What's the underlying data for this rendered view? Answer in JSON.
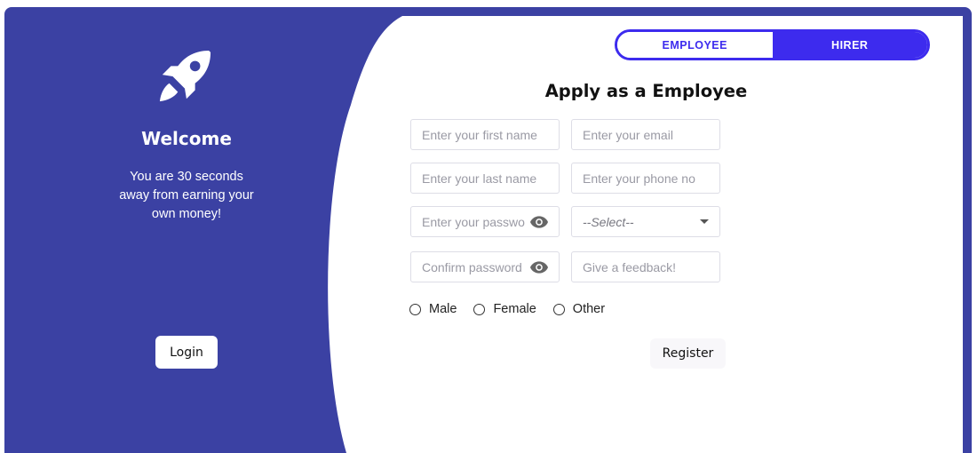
{
  "welcome_panel": {
    "heading": "Welcome",
    "tagline": "You are 30 seconds away from earning your own money!",
    "login_label": "Login"
  },
  "role_toggle": {
    "employee_label": "EMPLOYEE",
    "hirer_label": "HIRER"
  },
  "form": {
    "title": "Apply as a Employee",
    "first_name_placeholder": "Enter your first name",
    "email_placeholder": "Enter your email",
    "last_name_placeholder": "Enter your last name",
    "phone_placeholder": "Enter your phone no",
    "password_placeholder": "Enter your password",
    "select_value": "--Select--",
    "confirm_password_placeholder": "Confirm password",
    "feedback_placeholder": "Give a feedback!",
    "gender_options": [
      "Male",
      "Female",
      "Other"
    ],
    "register_label": "Register"
  },
  "icons": {
    "logo": "rocket-icon",
    "password_toggle": "eye-icon",
    "dropdown": "chevron-down-icon"
  },
  "colors": {
    "panel_bg": "#3b41a3",
    "accent": "#3d2bee",
    "button_bg": "#f8f7fa"
  }
}
